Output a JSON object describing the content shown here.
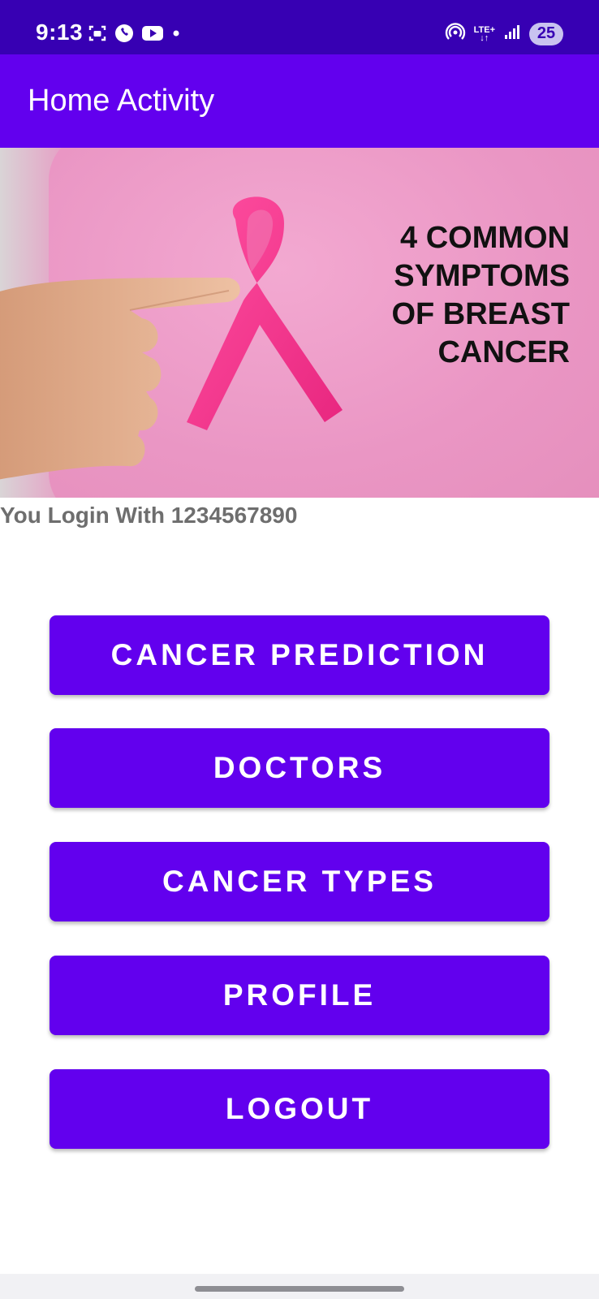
{
  "status_bar": {
    "time": "9:13",
    "lte_label": "LTE+",
    "battery": "25",
    "icons_left": [
      "screenshot-icon",
      "viber-icon",
      "youtube-icon",
      "dot-icon"
    ],
    "icons_right": [
      "hotspot-icon",
      "lte-data-icon",
      "signal-icon",
      "battery-icon"
    ]
  },
  "app_bar": {
    "title": "Home Activity"
  },
  "banner": {
    "lines": [
      "4 COMMON",
      "SYMPTOMS",
      "OF BREAST",
      "CANCER"
    ]
  },
  "login": {
    "text": "You Login With 1234567890"
  },
  "menu": {
    "buttons": [
      {
        "label": "CANCER PREDICTION"
      },
      {
        "label": "DOCTORS"
      },
      {
        "label": "CANCER TYPES"
      },
      {
        "label": "PROFILE"
      },
      {
        "label": "LOGOUT"
      }
    ]
  },
  "colors": {
    "status_bar": "#3700b3",
    "primary": "#6200ee",
    "login_text": "#6e6e6e"
  }
}
